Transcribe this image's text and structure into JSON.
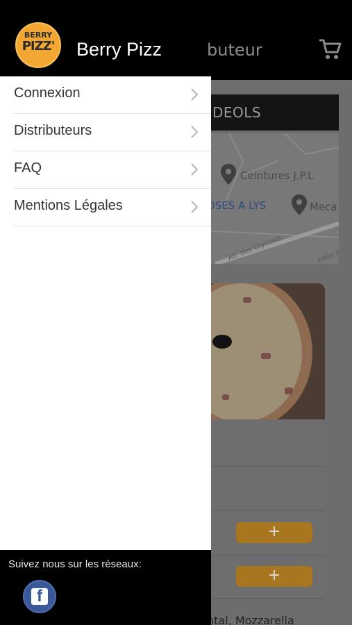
{
  "app": {
    "brand_name": "Berry Pizz",
    "logo_text_top": "BERRY",
    "logo_text_bottom": "PIZZ'",
    "behind_title": "buteur",
    "cart_icon": "cart-icon"
  },
  "background": {
    "distributor_name": "DEOLS",
    "map_labels": [
      "Ceintures J.P.L",
      "OSES A LYS",
      "Meca"
    ],
    "map_roads": [
      "All. des Glycines",
      "Allée de l"
    ],
    "add_button_label": "+",
    "description_snippet": "ntal, Mozzarella"
  },
  "drawer": {
    "items": [
      {
        "label": "Connexion"
      },
      {
        "label": "Distributeurs"
      },
      {
        "label": "FAQ"
      },
      {
        "label": "Mentions Légales"
      }
    ],
    "footer_text": "Suivez nous sur les réseaux:",
    "social": [
      {
        "icon": "facebook-icon",
        "letter": "f"
      }
    ]
  },
  "colors": {
    "header_bg": "#000000",
    "drawer_bg": "#ffffff",
    "accent_orange": "#f2a733",
    "add_button": "#a8761f",
    "facebook_blue": "#3b5998"
  }
}
